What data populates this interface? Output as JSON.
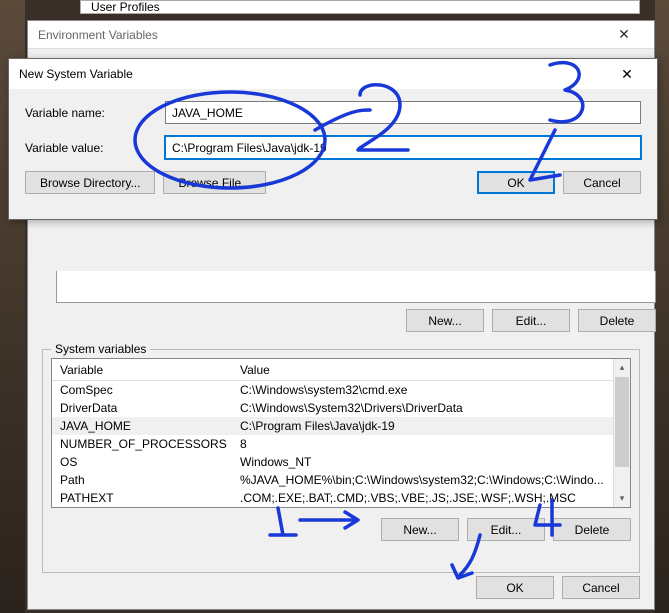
{
  "partial_top": {
    "label": "User Profiles"
  },
  "env_window": {
    "title": "Environment Variables",
    "upper_buttons": {
      "new": "New...",
      "edit": "Edit...",
      "delete": "Delete"
    },
    "system_section": {
      "label": "System variables",
      "col_variable": "Variable",
      "col_value": "Value",
      "rows": [
        {
          "var": "ComSpec",
          "val": "C:\\Windows\\system32\\cmd.exe"
        },
        {
          "var": "DriverData",
          "val": "C:\\Windows\\System32\\Drivers\\DriverData"
        },
        {
          "var": "JAVA_HOME",
          "val": "C:\\Program Files\\Java\\jdk-19"
        },
        {
          "var": "NUMBER_OF_PROCESSORS",
          "val": "8"
        },
        {
          "var": "OS",
          "val": "Windows_NT"
        },
        {
          "var": "Path",
          "val": "%JAVA_HOME%\\bin;C:\\Windows\\system32;C:\\Windows;C:\\Windo..."
        },
        {
          "var": "PATHEXT",
          "val": ".COM;.EXE;.BAT;.CMD;.VBS;.VBE;.JS;.JSE;.WSF;.WSH;.MSC"
        }
      ],
      "buttons": {
        "new": "New...",
        "edit": "Edit...",
        "delete": "Delete"
      }
    },
    "footer": {
      "ok": "OK",
      "cancel": "Cancel"
    }
  },
  "new_var_dialog": {
    "title": "New System Variable",
    "name_label": "Variable name:",
    "name_value": "JAVA_HOME",
    "value_label": "Variable value:",
    "value_value": "C:\\Program Files\\Java\\jdk-19",
    "browse_dir": "Browse Directory...",
    "browse_file": "Browse File...",
    "ok": "OK",
    "cancel": "Cancel"
  },
  "annotations": {
    "one": "1",
    "two": "2",
    "three": "3",
    "four": "4"
  }
}
